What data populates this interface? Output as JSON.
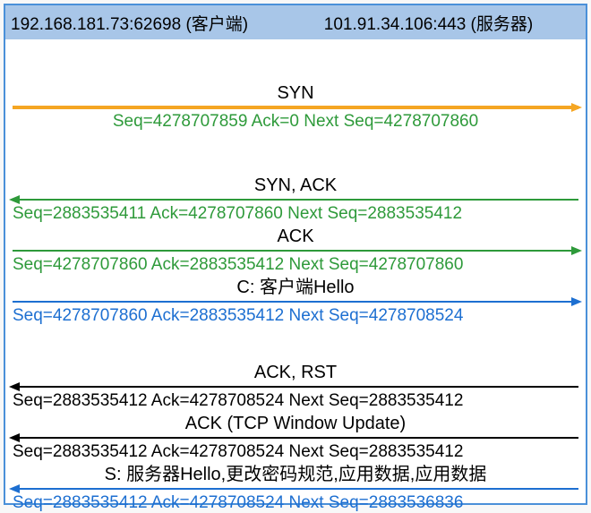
{
  "header": {
    "client": "192.168.181.73:62698  (客户端)",
    "server": "101.91.34.106:443 (服务器)"
  },
  "flows": [
    {
      "label": "SYN",
      "label_color": "black",
      "arrow_color": "orange",
      "direction": "right",
      "thick": true,
      "seq_text": "Seq=4278707859  Ack=0  Next Seq=4278707860",
      "seq_color": "green",
      "seq_align": "center",
      "gap_after": "lg"
    },
    {
      "label": "SYN, ACK",
      "label_color": "black",
      "arrow_color": "green",
      "direction": "left",
      "seq_text": "Seq=2883535411   Ack=4278707860   Next Seq=2883535412",
      "seq_color": "green",
      "seq_align": "left",
      "gap_after": ""
    },
    {
      "label": "ACK",
      "label_color": "black",
      "arrow_color": "green",
      "direction": "right",
      "seq_text": "Seq=4278707860   Ack=2883535412   Next Seq=4278707860",
      "seq_color": "green",
      "seq_align": "left",
      "gap_after": ""
    },
    {
      "label": "C: 客户端Hello",
      "label_color": "black",
      "arrow_color": "blue",
      "direction": "right",
      "seq_text": "Seq=4278707860   Ack=2883535412   Next Seq=4278708524",
      "seq_color": "blue",
      "seq_align": "left",
      "gap_after": "xl"
    },
    {
      "label": "ACK, RST",
      "label_color": "black",
      "arrow_color": "black",
      "direction": "left",
      "seq_text": "Seq=2883535412   Ack=4278708524   Next Seq=2883535412",
      "seq_color": "black",
      "seq_align": "left",
      "gap_after": ""
    },
    {
      "label": "ACK  (TCP Window Update)",
      "label_color": "black",
      "arrow_color": "black",
      "direction": "left",
      "seq_text": "Seq=2883535412   Ack=4278708524   Next Seq=2883535412",
      "seq_color": "black",
      "seq_align": "left",
      "gap_after": ""
    },
    {
      "label": "S: 服务器Hello,更改密码规范,应用数据,应用数据",
      "label_color": "black",
      "arrow_color": "blue",
      "direction": "left",
      "seq_text": "Seq=2883535412   Ack=4278708524   Next Seq=2883536836",
      "seq_color": "blue",
      "seq_align": "left",
      "gap_after": ""
    }
  ]
}
